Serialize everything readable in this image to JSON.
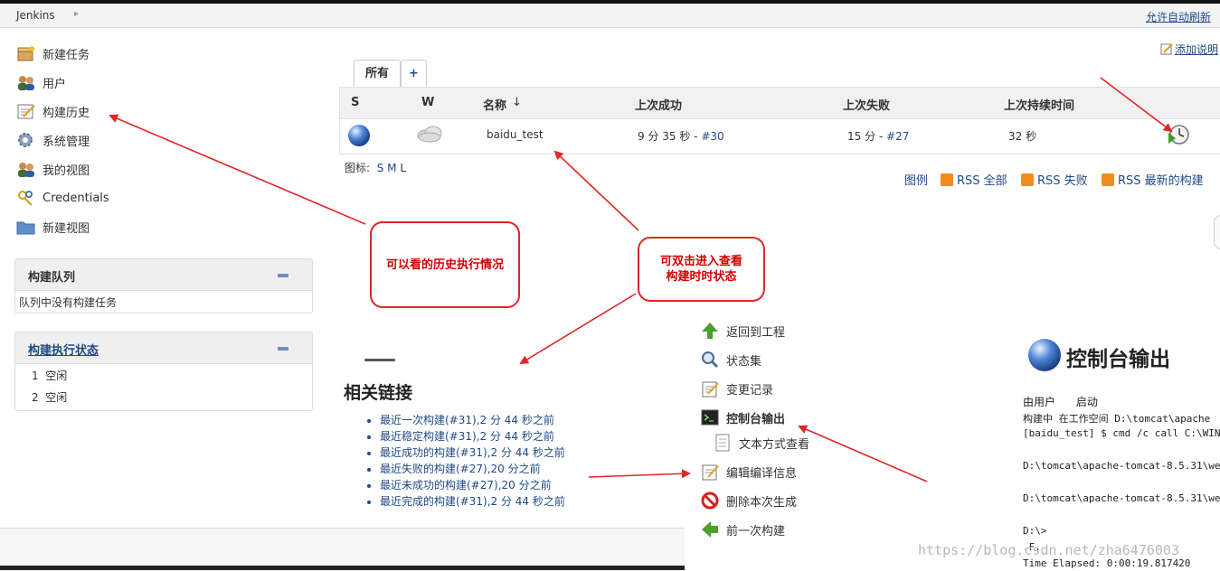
{
  "header": {
    "breadcrumb": "Jenkins",
    "auto_refresh": "允许自动刷新"
  },
  "sidebar": {
    "items": [
      {
        "label": "新建任务",
        "icon": "new-job-icon"
      },
      {
        "label": "用户",
        "icon": "users-icon"
      },
      {
        "label": "构建历史",
        "icon": "notepad-icon"
      },
      {
        "label": "系统管理",
        "icon": "gear-icon"
      },
      {
        "label": "我的视图",
        "icon": "users-icon"
      },
      {
        "label": "Credentials",
        "icon": "keys-icon"
      },
      {
        "label": "新建视图",
        "icon": "folder-icon"
      }
    ],
    "queue": {
      "title": "构建队列",
      "empty": "队列中没有构建任务"
    },
    "executors": {
      "title": "构建执行状态",
      "rows": [
        {
          "num": "1",
          "state": "空闲"
        },
        {
          "num": "2",
          "state": "空闲"
        }
      ]
    }
  },
  "main": {
    "tabs": [
      {
        "label": "所有"
      },
      {
        "label": "+"
      }
    ],
    "add_description": "添加说明",
    "table": {
      "headers": {
        "s": "S",
        "w": "W",
        "name": "名称",
        "sort": "↓",
        "last_success": "上次成功",
        "last_failure": "上次失败",
        "last_duration": "上次持续时间"
      },
      "row": {
        "name": "baidu_test",
        "success_text": "9 分 35 秒 - ",
        "success_link": "#30",
        "failure_text": "15 分 - ",
        "failure_link": "#27",
        "duration": "32 秒"
      }
    },
    "icon_size": {
      "label": "图标:",
      "s": "S",
      "m": "M",
      "l": "L"
    },
    "legend": "图例",
    "rss": [
      "RSS 全部",
      "RSS 失败",
      "RSS 最新的构建"
    ]
  },
  "annotations": {
    "history": "可以看的历史执行情况",
    "double_click_line1": "可双击进入查看",
    "double_click_line2": "构建时时状态"
  },
  "related": {
    "title": "相关链接",
    "links": [
      "最近一次构建(#31),2 分 44 秒之前",
      "最近稳定构建(#31),2 分 44 秒之前",
      "最近成功的构建(#31),2 分 44 秒之前",
      "最近失败的构建(#27),20 分之前",
      "最近未成功的构建(#27),20 分之前",
      "最近完成的构建(#31),2 分 44 秒之前"
    ]
  },
  "build_menu": [
    "返回到工程",
    "状态集",
    "变更记录",
    "控制台输出",
    "文本方式查看",
    "编辑编译信息",
    "删除本次生成",
    "前一次构建"
  ],
  "console": {
    "title": "控制台输出",
    "lines": [
      "由用户      启动",
      "构建中 在工作空间 D:\\tomcat\\apache",
      "[baidu_test] $ cmd /c call C:\\WIN",
      "D:\\tomcat\\apache-tomcat-8.5.31\\web",
      "D:\\tomcat\\apache-tomcat-8.5.31\\web",
      "D:\\>",
      ".F.",
      "Time Elapsed: 0:00:19.817420"
    ]
  },
  "watermark": "https://blog.csdn.net/zha6476003"
}
